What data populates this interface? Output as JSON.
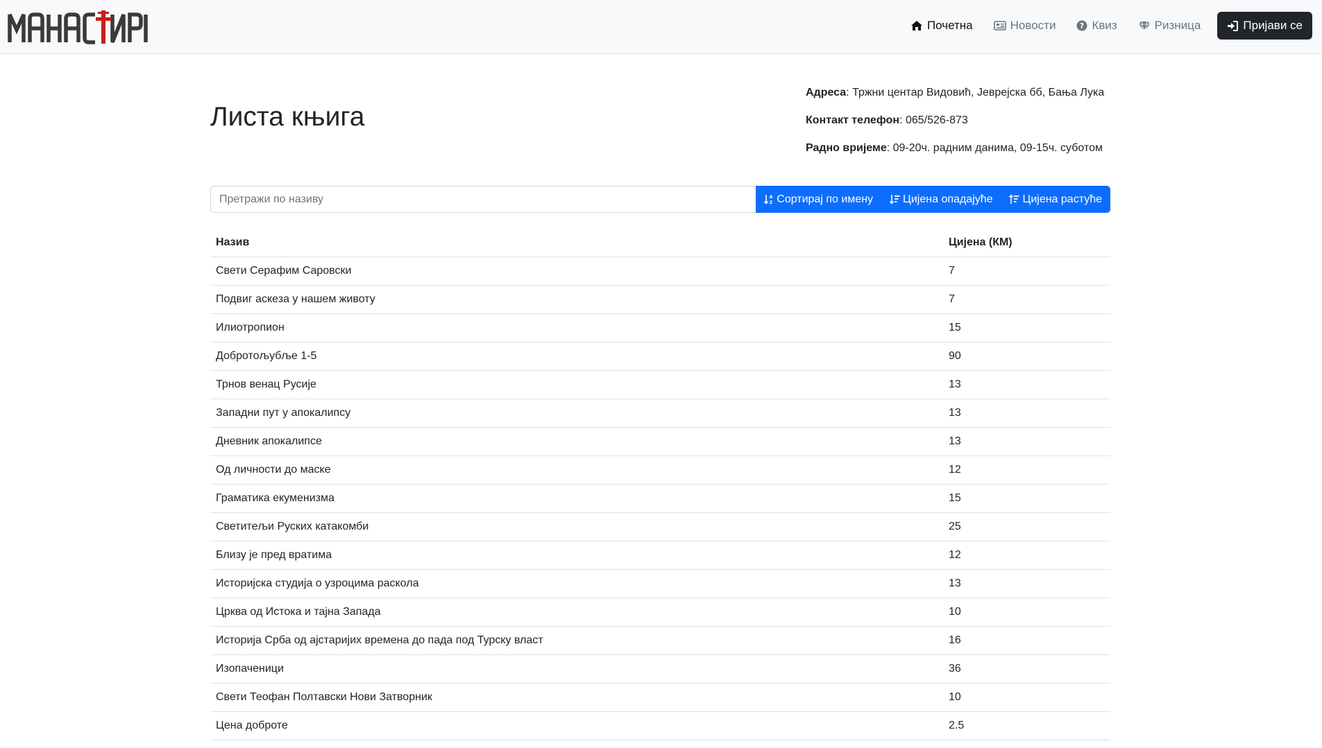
{
  "brand": {
    "name": "МАНАСТИРИ"
  },
  "nav": {
    "items": [
      {
        "label": "Почетна",
        "icon": "home-icon",
        "active": true
      },
      {
        "label": "Новости",
        "icon": "newspaper-icon",
        "active": false
      },
      {
        "label": "Квиз",
        "icon": "question-circle-icon",
        "active": false
      },
      {
        "label": "Ризница",
        "icon": "gem-icon",
        "active": false
      }
    ],
    "login_label": "Пријави се",
    "login_icon": "sign-in-icon"
  },
  "page": {
    "title": "Листа књига"
  },
  "info": {
    "address_label": "Адреса",
    "address_value": ": Тржни центар Видовић, Јеврејска бб, Бања Лука",
    "phone_label": "Контакт телефон",
    "phone_value": ": 065/526-873",
    "hours_label": "Радно вријеме",
    "hours_value": ": 09-20ч. радним данима, 09-15ч. суботом"
  },
  "search": {
    "placeholder": "Претражи по називу",
    "value": ""
  },
  "sort_buttons": [
    {
      "label": "Сортирај по имену",
      "icon": "sort-alpha-icon"
    },
    {
      "label": "Цијена опадајуће",
      "icon": "sort-desc-icon"
    },
    {
      "label": "Цијена растуће",
      "icon": "sort-asc-icon"
    }
  ],
  "table": {
    "columns": [
      "Назив",
      "Цијена (КМ)"
    ],
    "rows": [
      {
        "name": "Свети Серафим Саровски",
        "price": "7"
      },
      {
        "name": "Подвиг аскеза у нашем животу",
        "price": "7"
      },
      {
        "name": "Илиотропион",
        "price": "15"
      },
      {
        "name": "Добротољубље 1-5",
        "price": "90"
      },
      {
        "name": "Трнов венац Русије",
        "price": "13"
      },
      {
        "name": "Западни пут у апокалипсу",
        "price": "13"
      },
      {
        "name": "Дневник апокалипсе",
        "price": "13"
      },
      {
        "name": "Од личности до маске",
        "price": "12"
      },
      {
        "name": "Граматика екуменизма",
        "price": "15"
      },
      {
        "name": "Светитељи Руских катакомби",
        "price": "25"
      },
      {
        "name": "Близу је пред вратима",
        "price": "12"
      },
      {
        "name": "Историјска студија о узроцима раскола",
        "price": "13"
      },
      {
        "name": "Црква од Истока и тајна Запада",
        "price": "10"
      },
      {
        "name": "Историја Срба од ајстаријих времена до пада под Турску власт",
        "price": "16"
      },
      {
        "name": "Изопаченици",
        "price": "36"
      },
      {
        "name": "Свети Теофан Полтавски Нови Затворник",
        "price": "10"
      },
      {
        "name": "Цена доброте",
        "price": "2.5"
      }
    ]
  },
  "colors": {
    "primary": "#0d6efd",
    "dark": "#212529",
    "cross": "#c41e1e",
    "navbar": "#f8f9fa"
  }
}
